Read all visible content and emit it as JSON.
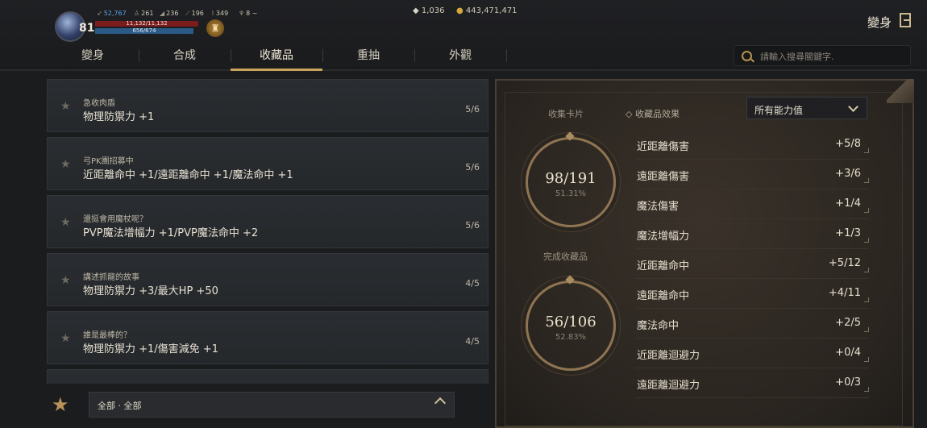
{
  "player": {
    "level": "81",
    "stats": [
      {
        "icon": "wing-icon",
        "value": "52,767",
        "color": "#5aa0e0"
      },
      {
        "icon": "person-icon",
        "value": "261"
      },
      {
        "icon": "sword-icon",
        "value": "236"
      },
      {
        "icon": "dagger-icon",
        "value": "196"
      },
      {
        "icon": "bow-icon",
        "value": "349"
      },
      {
        "icon": "trophy-icon",
        "value": "8"
      }
    ],
    "hp": "11,132/11,132",
    "mp": "656/674"
  },
  "currency": {
    "gem": "1,036",
    "gold": "443,471,471"
  },
  "header": {
    "title": "變身"
  },
  "tabs": [
    {
      "label": "變身"
    },
    {
      "label": "合成"
    },
    {
      "label": "收藏品",
      "active": true
    },
    {
      "label": "重抽"
    },
    {
      "label": "外觀"
    }
  ],
  "search": {
    "placeholder": "請輸入搜尋關鍵字."
  },
  "collections": [
    {
      "name": "急收肉盾",
      "effect": "物理防禦力 +1",
      "count": "5/6"
    },
    {
      "name": "弓PK團招募中",
      "effect": "近距離命中 +1/遠距離命中 +1/魔法命中 +1",
      "count": "5/6"
    },
    {
      "name": "還挺會用魔杖呢？",
      "effect": "PVP魔法增幅力 +1/PVP魔法命中 +2",
      "count": "5/6"
    },
    {
      "name": "講述抓龍的故事",
      "effect": "物理防禦力 +3/最大HP +50",
      "count": "4/5"
    },
    {
      "name": "誰是最棒的？",
      "effect": "物理防禦力 +1/傷害減免 +1",
      "count": "4/5"
    }
  ],
  "filter": {
    "label": "全部 · 全部"
  },
  "summary": {
    "cards_label": "收集卡片",
    "cards_value": "98/191",
    "cards_pct": "51.31%",
    "cards_fraction": 0.5131,
    "complete_label": "完成收藏品",
    "complete_value": "56/106",
    "complete_pct": "52.83%",
    "complete_fraction": 0.5283
  },
  "effects": {
    "header": "收藏品效果",
    "dropdown": "所有能力值",
    "rows": [
      {
        "label": "近距離傷害",
        "value": "+5/8"
      },
      {
        "label": "遠距離傷害",
        "value": "+3/6"
      },
      {
        "label": "魔法傷害",
        "value": "+1/4"
      },
      {
        "label": "魔法增幅力",
        "value": "+1/3"
      },
      {
        "label": "近距離命中",
        "value": "+5/12"
      },
      {
        "label": "遠距離命中",
        "value": "+4/11"
      },
      {
        "label": "魔法命中",
        "value": "+2/5"
      },
      {
        "label": "近距離迴避力",
        "value": "+0/4"
      },
      {
        "label": "遠距離迴避力",
        "value": "+0/3"
      }
    ]
  }
}
